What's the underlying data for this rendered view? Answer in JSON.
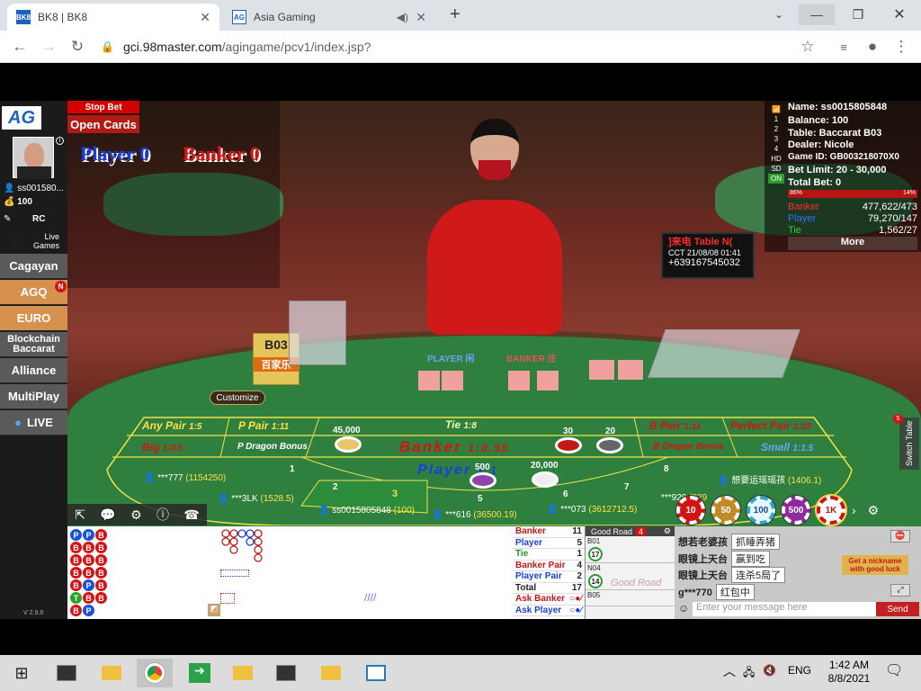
{
  "browser": {
    "tabs": [
      {
        "title": "BK8 | BK8",
        "favicon": "BK8",
        "active": true
      },
      {
        "title": "Asia Gaming",
        "favicon": "AG",
        "active": false
      }
    ],
    "url_domain": "gci.98master.com",
    "url_path": "/agingame/pcv1/index.jsp?"
  },
  "sidebar": {
    "logo": "AG",
    "username": "ss001580...",
    "balance": "100",
    "rc_label": "RC",
    "live_games_label": "Live Games",
    "items": [
      {
        "label": "Cagayan",
        "highlight": false
      },
      {
        "label": "AGQ",
        "highlight": true,
        "badge": "N"
      },
      {
        "label": "EURO",
        "highlight": true
      },
      {
        "label": "Blockchain Baccarat",
        "highlight": false
      },
      {
        "label": "Alliance",
        "highlight": false
      },
      {
        "label": "MultiPlay",
        "highlight": false
      },
      {
        "label": "LIVE",
        "highlight": false
      }
    ],
    "version": "V 2.9.8"
  },
  "hud": {
    "stop_bet": "Stop Bet",
    "open_cards": "Open Cards",
    "player_label": "Player",
    "player_score": "0",
    "banker_label": "Banker",
    "banker_score": "0"
  },
  "info": {
    "name": "Name: ss0015805848",
    "balance": "Balance: 100",
    "table": "Table: Baccarat B03",
    "dealer": "Dealer: Nicole",
    "game_id": "Game ID: GB003218070X0",
    "bet_limit": "Bet Limit: 20 - 30,000",
    "total_bet": "Total Bet: 0",
    "pct_left": "86%",
    "pct_right": "14%",
    "stats": [
      {
        "label": "Banker",
        "value": "477,622/473",
        "color": "#ff3030"
      },
      {
        "label": "Player",
        "value": "79,270/147",
        "color": "#3a6bff"
      },
      {
        "label": "Tie",
        "value": "1,562/27",
        "color": "#34c934"
      }
    ],
    "more": "More",
    "side_icons": [
      "1",
      "2",
      "3",
      "4",
      "HD",
      "SD",
      "ON"
    ]
  },
  "monitor": {
    "line1": "]来电  Table N(",
    "line2": "CCT 21/08/08 01:41",
    "line3": "+639167545032"
  },
  "table_labels": {
    "shoe_tag": "B03",
    "shoe_sub": "百家乐",
    "player_zh": "PLAYER 闲",
    "banker_zh": "BANKER 庄"
  },
  "customize": "Customize",
  "bets": {
    "any_pair": "Any Pair",
    "any_pair_odds": "1:5",
    "p_pair": "P Pair",
    "p_pair_odds": "1:11",
    "tie": "Tie",
    "tie_odds": "1:8",
    "b_pair": "B Pair",
    "b_pair_odds": "1:11",
    "perfect_pair": "Perfect Pair",
    "perfect_pair_odds": "1:25",
    "big": "Big",
    "big_odds": "1:0.5",
    "p_dragon": "P Dragon Bonus",
    "banker": "Banker",
    "banker_odds": "1:0.95",
    "b_dragon": "B Dragon Bonus",
    "small": "Small",
    "small_odds": "1:1.5",
    "player": "Player",
    "player_odds": "1:1",
    "chip_amounts": [
      "45,000",
      "30",
      "20",
      "500",
      "20,000"
    ],
    "seats": [
      {
        "name": "***777",
        "amount": "(1154250)"
      },
      {
        "name": "***3LK",
        "amount": "(1528.5)"
      },
      {
        "name": "ss0015805848",
        "amount": "(100)"
      },
      {
        "name": "***616",
        "amount": "(36500.19)"
      },
      {
        "name": "***073",
        "amount": "(3612712.5)"
      },
      {
        "name": "***929",
        "amount": "(929"
      },
      {
        "name": "想要运瑶瑶孩",
        "amount": "(1406.1)"
      }
    ],
    "seat_numbers": [
      "1",
      "2",
      "3",
      "5",
      "6",
      "7",
      "8"
    ]
  },
  "chips": [
    "10",
    "50",
    "100",
    "500",
    "1K"
  ],
  "road": {
    "bead": [
      [
        "P",
        "B",
        "B",
        "B",
        "B",
        "T",
        "B"
      ],
      [
        "P",
        "B",
        "B",
        "B",
        "P",
        "B",
        "P"
      ],
      [
        "B",
        "B",
        "B",
        "B",
        "B",
        "B",
        ""
      ]
    ],
    "bead_colors": {
      "P": "#1b4fd6",
      "B": "#d41414",
      "T": "#24a524"
    }
  },
  "stats": [
    {
      "label": "Banker",
      "value": "11",
      "color": "#c41818"
    },
    {
      "label": "Player",
      "value": "5",
      "color": "#1b3fd6"
    },
    {
      "label": "Tie",
      "value": "1",
      "color": "#1c9a1c"
    },
    {
      "label": "Banker Pair",
      "value": "4",
      "color": "#c41818"
    },
    {
      "label": "Player Pair",
      "value": "2",
      "color": "#1b3fd6"
    },
    {
      "label": "Total",
      "value": "17",
      "color": "#222"
    },
    {
      "label": "Ask Banker",
      "value": "",
      "color": "#c41818"
    },
    {
      "label": "Ask Player",
      "value": "",
      "color": "#1b3fd6"
    }
  ],
  "goodroad": {
    "title": "Good Road",
    "badge": "4",
    "tables": [
      {
        "name": "B01",
        "timer": "17"
      },
      {
        "name": "N04",
        "timer": "14"
      },
      {
        "name": "B05",
        "timer": ""
      }
    ],
    "overlay": "Good Road"
  },
  "chat": {
    "messages": [
      {
        "user": "想若老婆孩",
        "text": "抓睡弄猪"
      },
      {
        "user": "眼镜上天台",
        "text": "赢到吃"
      },
      {
        "user": "眼镜上天台",
        "text": "连杀5局了"
      },
      {
        "user": "g***770",
        "text": "红包中"
      }
    ],
    "promo": "Get a nickname with good luck",
    "placeholder": "Enter your message here",
    "send": "Send"
  },
  "taskbar": {
    "lang": "ENG",
    "time": "1:42 AM",
    "date": "8/8/2021"
  }
}
